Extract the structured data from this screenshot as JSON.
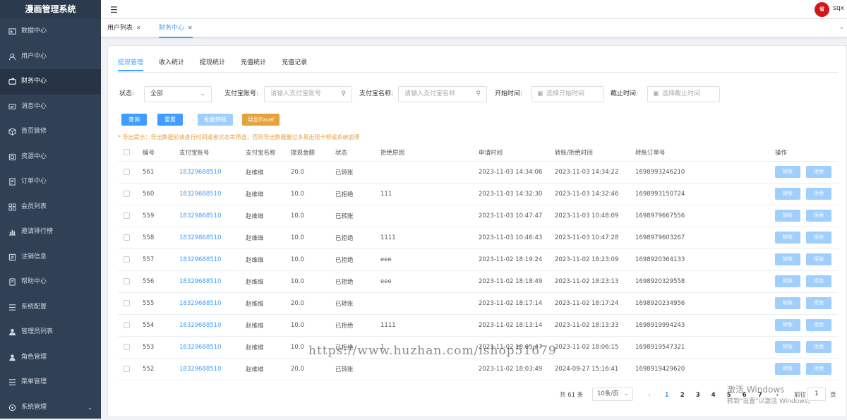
{
  "app": {
    "title": "漫画管理系统"
  },
  "sidebar": {
    "items": [
      {
        "label": "数据中心",
        "icon": "dashboard-icon"
      },
      {
        "label": "用户中心",
        "icon": "user-icon"
      },
      {
        "label": "财务中心",
        "icon": "wallet-icon",
        "active": true
      },
      {
        "label": "消息中心",
        "icon": "message-icon"
      },
      {
        "label": "首页装修",
        "icon": "cube-icon"
      },
      {
        "label": "资源中心",
        "icon": "resource-icon"
      },
      {
        "label": "订单中心",
        "icon": "order-icon"
      },
      {
        "label": "会员列表",
        "icon": "grid-icon"
      },
      {
        "label": "邀请排行榜",
        "icon": "bar-chart-icon"
      },
      {
        "label": "注销信息",
        "icon": "list-icon"
      },
      {
        "label": "帮助中心",
        "icon": "help-doc-icon"
      },
      {
        "label": "系统配置",
        "icon": "settings-list-icon"
      },
      {
        "label": "管理员列表",
        "icon": "admin-icon"
      },
      {
        "label": "角色管理",
        "icon": "role-icon"
      },
      {
        "label": "菜单管理",
        "icon": "menu-list-icon"
      },
      {
        "label": "系统管理",
        "icon": "gear-icon"
      }
    ]
  },
  "header": {
    "username": "sqx",
    "avatar_text": "省"
  },
  "tags": [
    {
      "label": "用户列表"
    },
    {
      "label": "财务中心",
      "active": true
    }
  ],
  "tabs": [
    "提现管理",
    "收入统计",
    "提现统计",
    "充值统计",
    "充值记录"
  ],
  "filters": {
    "status_label": "状态:",
    "status_value": "全部",
    "alipay_account_label": "支付宝账号:",
    "alipay_account_placeholder": "请输入支付宝账号",
    "alipay_name_label": "支付宝名称:",
    "alipay_name_placeholder": "请输入支付宝名称",
    "start_label": "开始时间:",
    "start_placeholder": "选择开始时间",
    "end_label": "截止时间:",
    "end_placeholder": "选择截止时间"
  },
  "buttons": {
    "query": "查询",
    "reset": "重置",
    "batch": "批量转账",
    "export": "导出Excel"
  },
  "notice": "* 导出提示：导出数据前请进行时间或者状态等筛选，否则导出数据量过多易出现卡顿或系统崩溃",
  "table": {
    "headers": [
      "编号",
      "支付宝账号",
      "支付宝名称",
      "提现金额",
      "状态",
      "拒绝原因",
      "申请时间",
      "转账/拒绝时间",
      "转账订单号",
      "操作"
    ],
    "action_transfer": "转账",
    "action_reject": "拒绝",
    "rows": [
      [
        "561",
        "18329688510",
        "赵维维",
        "20.0",
        "已转账",
        "",
        "2023-11-03 14:34:06",
        "2023-11-03 14:34:22",
        "1698993246210"
      ],
      [
        "560",
        "18329688510",
        "赵维维",
        "10.0",
        "已拒绝",
        "111",
        "2023-11-03 14:32:30",
        "2023-11-03 14:32:46",
        "1698993150724"
      ],
      [
        "559",
        "18329868510",
        "赵维维",
        "10.0",
        "已转账",
        "",
        "2023-11-03 10:47:47",
        "2023-11-03 10:48:09",
        "1698979667556"
      ],
      [
        "558",
        "18329868510",
        "赵维维",
        "10.0",
        "已拒绝",
        "1111",
        "2023-11-03 10:46:43",
        "2023-11-03 10:47:28",
        "1698979603267"
      ],
      [
        "557",
        "18329688510",
        "赵维维",
        "10.0",
        "已拒绝",
        "eee",
        "2023-11-02 18:19:24",
        "2023-11-02 18:23:09",
        "1698920364133"
      ],
      [
        "556",
        "18329688510",
        "赵维维",
        "10.0",
        "已拒绝",
        "eee",
        "2023-11-02 18:18:49",
        "2023-11-02 18:23:13",
        "1698920329558"
      ],
      [
        "555",
        "18329688510",
        "赵维维",
        "20.0",
        "已转账",
        "",
        "2023-11-02 18:17:14",
        "2023-11-02 18:17:24",
        "1698920234956"
      ],
      [
        "554",
        "18329688510",
        "赵维维",
        "10.0",
        "已拒绝",
        "1111",
        "2023-11-02 18:13:14",
        "2023-11-02 18:13:33",
        "1698919994243"
      ],
      [
        "553",
        "18329688510",
        "赵维维",
        "10.0",
        "已拒绝",
        "1",
        "2023-11-02 18:05:47",
        "2023-11-02 18:06:15",
        "1698919547321"
      ],
      [
        "552",
        "18329688510",
        "赵维维",
        "20.0",
        "已转账",
        "",
        "2023-11-02 18:03:49",
        "2024-09-27 15:16:41",
        "1698919429620"
      ]
    ]
  },
  "pagination": {
    "total": "共 61 条",
    "page_size": "10条/页",
    "pages": [
      "1",
      "2",
      "3",
      "4",
      "5",
      "6",
      "7"
    ],
    "current": "1",
    "goto_label": "前往",
    "goto_value": "1",
    "goto_suffix": "页",
    "prev": "‹",
    "next": "›"
  },
  "overlay": {
    "watermark": "https://www.huzhan.com/ishop51679",
    "activate_title": "激活 Windows",
    "activate_sub": "转到\"设置\"以激活 Windows。"
  },
  "colors": {
    "sidebar": "#304156",
    "accent": "#409eff",
    "export": "#e6a23c",
    "avatar": "#d7141a"
  }
}
